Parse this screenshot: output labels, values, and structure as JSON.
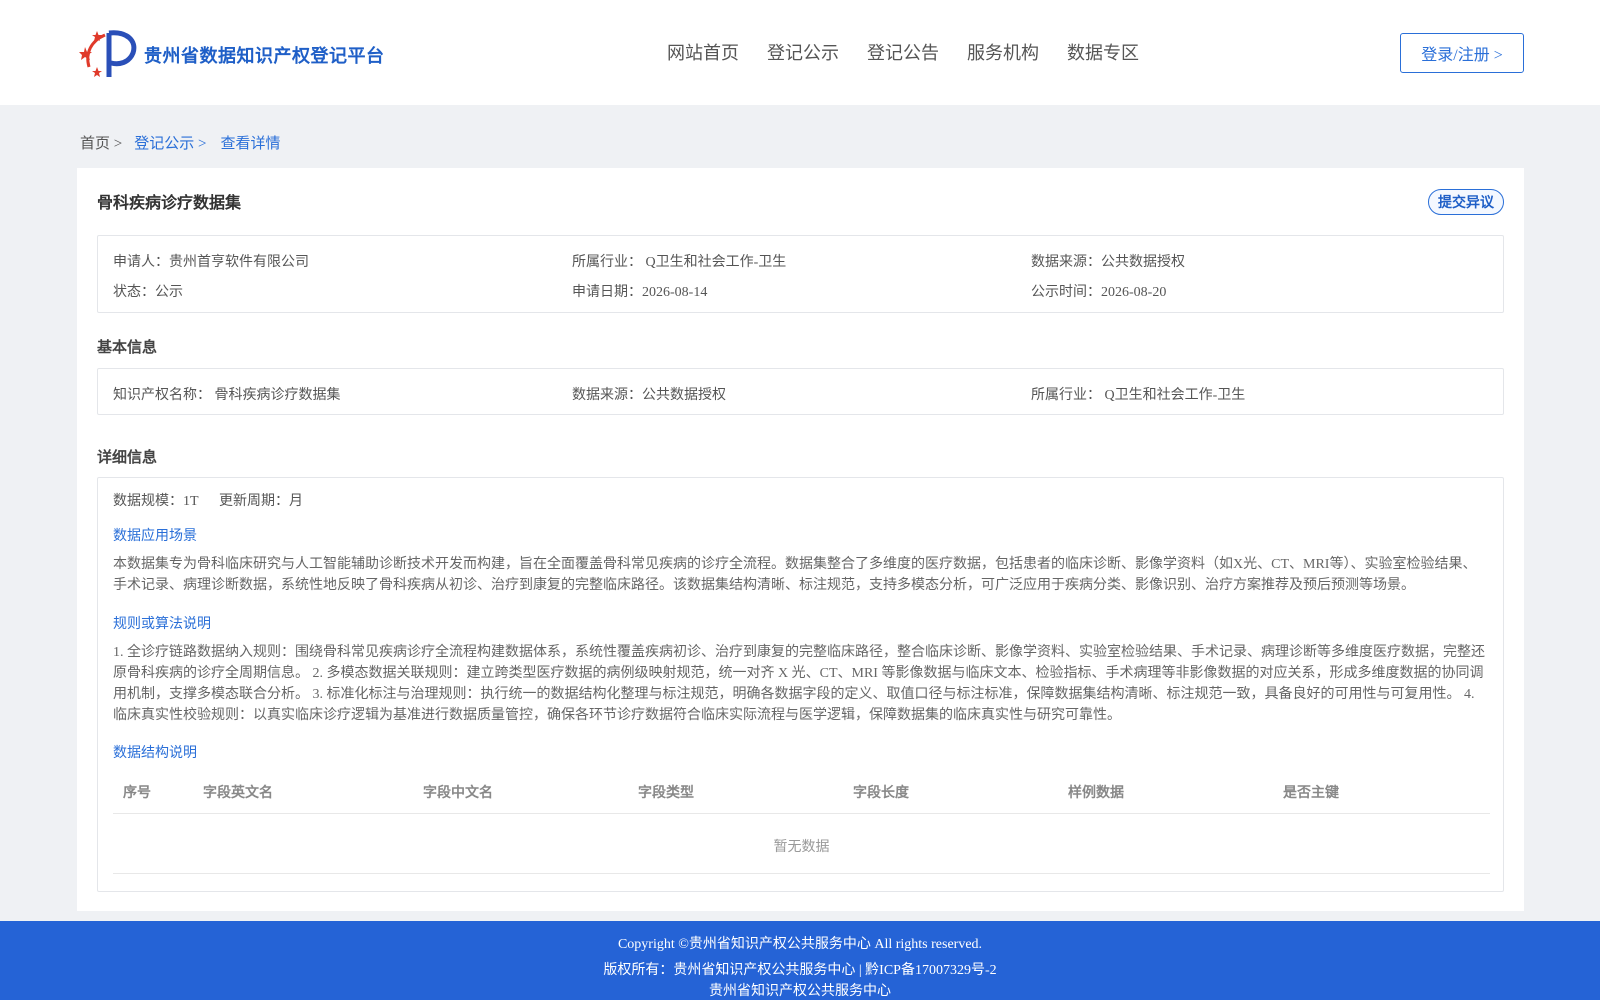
{
  "header": {
    "brand": "贵州省数据知识产权登记平台",
    "nav": [
      "网站首页",
      "登记公示",
      "登记公告",
      "服务机构",
      "数据专区"
    ],
    "login": "登录/注册 >"
  },
  "breadcrumb": {
    "home": "首页 >",
    "list": "登记公示 >",
    "current": "查看详情"
  },
  "dataset": {
    "title": "骨科疾病诊疗数据集",
    "dispute_button": "提交异议",
    "summary": {
      "applicant": "申请人：贵州首亨软件有限公司",
      "industry": "所属行业： Q卫生和社会工作-卫生",
      "source": "数据来源：公共数据授权",
      "status": "状态：公示",
      "apply_date": "申请日期：2026-08-14",
      "publish_date": "公示时间：2026-08-20"
    },
    "basic_title": "基本信息",
    "basic": {
      "ip_name": "知识产权名称： 骨科疾病诊疗数据集",
      "source": "数据来源：公共数据授权",
      "industry": "所属行业： Q卫生和社会工作-卫生"
    },
    "detail_title": "详细信息",
    "detail": {
      "scale": "数据规模：1T",
      "cycle": "更新周期：月",
      "scenario_title": "数据应用场景",
      "scenario_line1": "本数据集专为骨科临床研究与人工智能辅助诊断技术开发而构建，旨在全面覆盖骨科常见疾病的诊疗全流程。数据集整合了多维度的医疗数据，包括患者的临床诊断、影像学资料（如X光、CT、MRI等）、实验室检验结果、",
      "scenario_line2": "手术记录、病理诊断数据，系统性地反映了骨科疾病从初诊、治疗到康复的完整临床路径。该数据集结构清晰、标注规范，支持多模态分析，可广泛应用于疾病分类、影像识别、治疗方案推荐及预后预测等场景。",
      "rules_title": "规则或算法说明",
      "rules_line1": "1. 全诊疗链路数据纳入规则：围绕骨科常见疾病诊疗全流程构建数据体系，系统性覆盖疾病初诊、治疗到康复的完整临床路径，整合临床诊断、影像学资料、实验室检验结果、手术记录、病理诊断等多维度医疗数据，完整还",
      "rules_line2": "原骨科疾病的诊疗全周期信息。 2. 多模态数据关联规则：建立跨类型医疗数据的病例级映射规范，统一对齐 X 光、CT、MRI 等影像数据与临床文本、检验指标、手术病理等非影像数据的对应关系，形成多维度数据的协同调",
      "rules_line3": "用机制，支撑多模态联合分析。 3. 标准化标注与治理规则：执行统一的数据结构化整理与标注规范，明确各数据字段的定义、取值口径与标注标准，保障数据集结构清晰、标注规范一致，具备良好的可用性与可复用性。 4.",
      "rules_line4": "临床真实性校验规则：以真实临床诊疗逻辑为基准进行数据质量管控，确保各环节诊疗数据符合临床实际流程与医学逻辑，保障数据集的临床真实性与研究可靠性。",
      "structure_title": "数据结构说明",
      "columns": [
        "序号",
        "字段英文名",
        "字段中文名",
        "字段类型",
        "字段长度",
        "样例数据",
        "是否主键"
      ],
      "empty": "暂无数据"
    }
  },
  "footer": {
    "copyright": "Copyright ©贵州省知识产权公共服务中心 All rights reserved.",
    "owner": "版权所有：贵州省知识产权公共服务中心 | 黔ICP备17007329号-2",
    "org": "贵州省知识产权公共服务中心"
  },
  "colors": {
    "accent": "#2a6fd8",
    "footer_bg": "#2563d6",
    "page_bg": "#eff1f4"
  }
}
